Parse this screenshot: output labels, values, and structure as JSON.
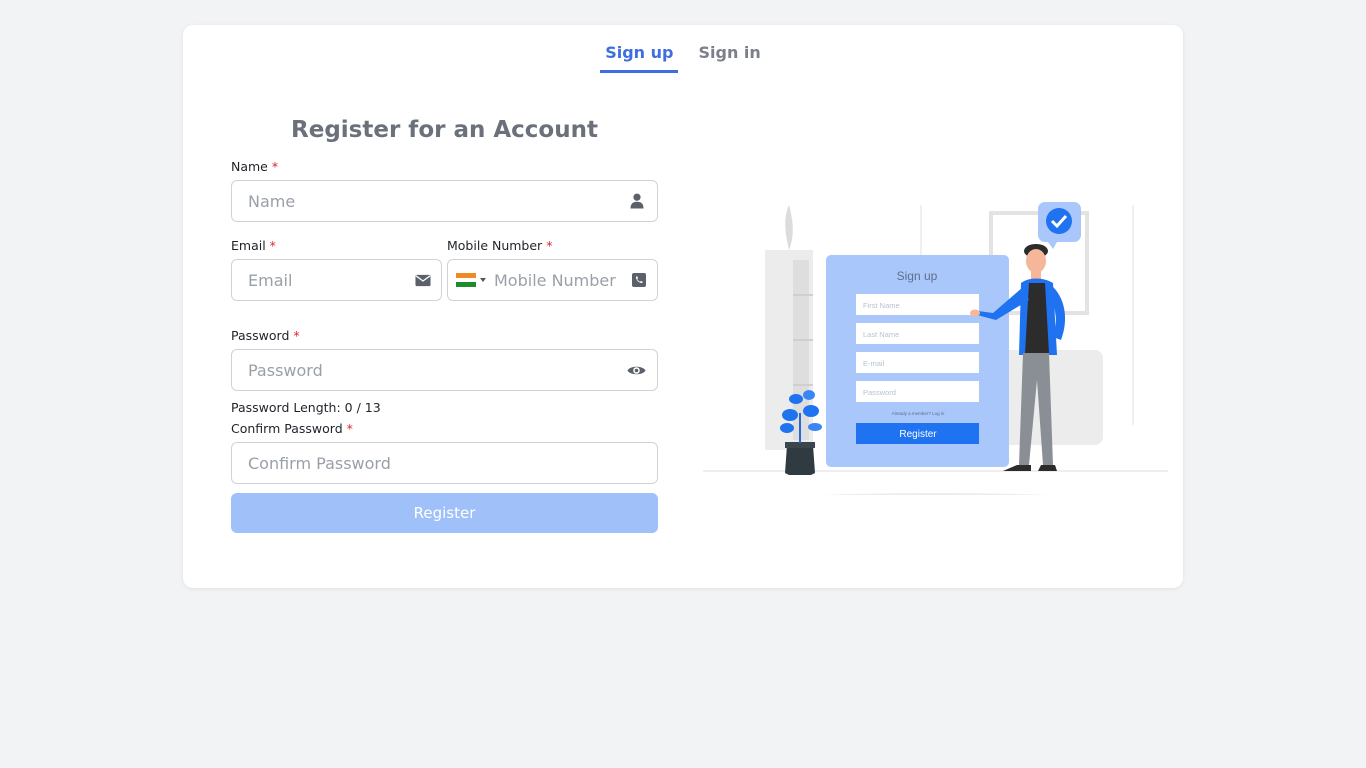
{
  "tabs": [
    {
      "label": "Sign up",
      "active": true
    },
    {
      "label": "Sign in",
      "active": false
    }
  ],
  "form": {
    "title": "Register for an Account",
    "required_mark": "*",
    "name": {
      "label": "Name",
      "placeholder": "Name",
      "value": ""
    },
    "email": {
      "label": "Email",
      "placeholder": "Email",
      "value": ""
    },
    "mobile": {
      "label": "Mobile Number",
      "placeholder": "Mobile Number",
      "value": "",
      "country": "India"
    },
    "password": {
      "label": "Password",
      "placeholder": "Password",
      "value": ""
    },
    "password_length": "Password Length: 0 / 13",
    "confirm_password": {
      "label": "Confirm Password",
      "placeholder": "Confirm Password",
      "value": ""
    },
    "register_label": "Register"
  },
  "illustration": {
    "card_title": "Sign up",
    "fields": [
      "First Name",
      "Last Name",
      "E-mail",
      "Password"
    ],
    "link_text": "Already a member? Log in",
    "button_label": "Register"
  },
  "icons": {
    "name": "user-icon",
    "email": "envelope-icon",
    "mobile": "phone-icon",
    "password": "eye-icon"
  },
  "colors": {
    "accent": "#3f6ee0",
    "button_disabled": "#a0c0fa",
    "required": "#e0232b",
    "illustration_blue": "#a9c7fb",
    "illustration_button": "#1f73f0"
  }
}
